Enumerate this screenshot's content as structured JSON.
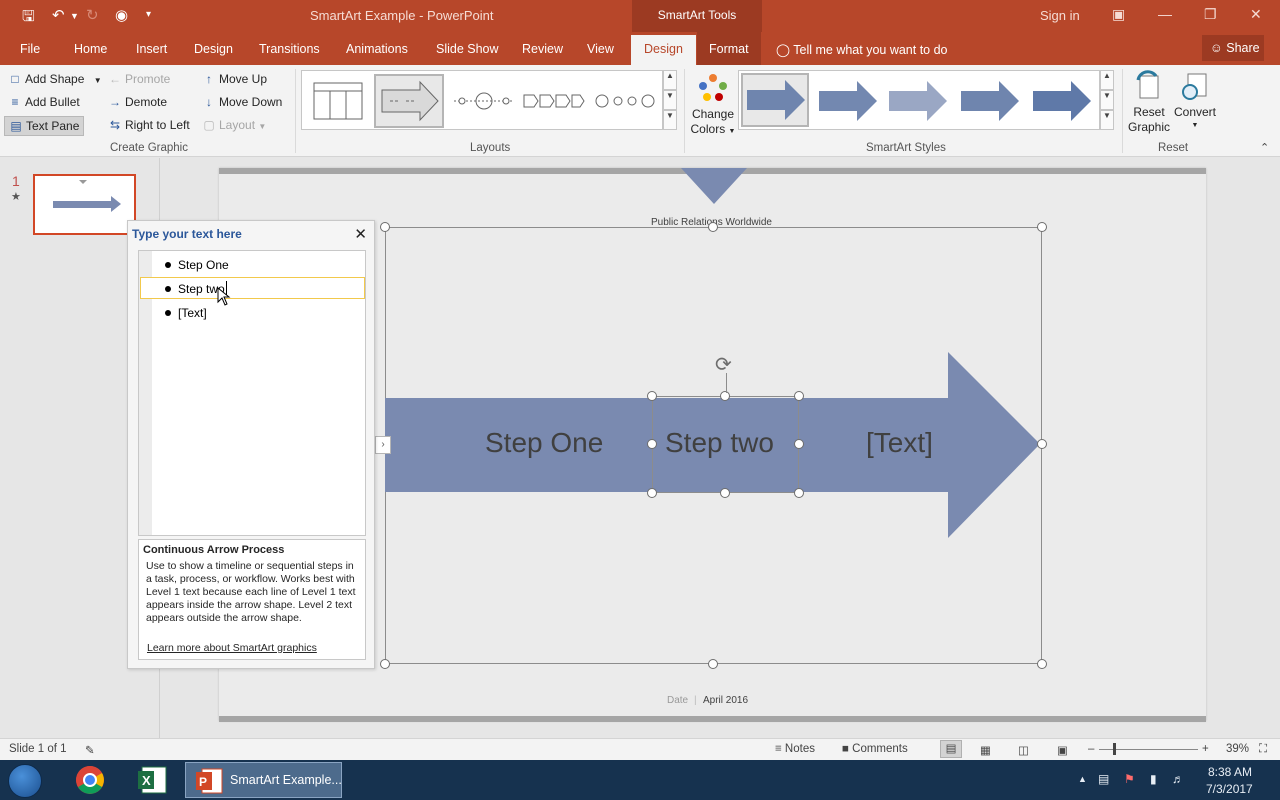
{
  "titlebar": {
    "title": "SmartArt Example  -  PowerPoint",
    "contextual": "SmartArt Tools",
    "signin": "Sign in"
  },
  "tabs": [
    {
      "label": "File"
    },
    {
      "label": "Home"
    },
    {
      "label": "Insert"
    },
    {
      "label": "Design"
    },
    {
      "label": "Transitions"
    },
    {
      "label": "Animations"
    },
    {
      "label": "Slide Show"
    },
    {
      "label": "Review"
    },
    {
      "label": "View"
    },
    {
      "label": "Design"
    },
    {
      "label": "Format"
    }
  ],
  "tellme": "Tell me what you want to do",
  "share": "Share",
  "ribbon": {
    "create_graphic": {
      "add_shape": "Add Shape",
      "add_bullet": "Add Bullet",
      "text_pane": "Text Pane",
      "promote": "Promote",
      "demote": "Demote",
      "right_to_left": "Right to Left",
      "move_up": "Move Up",
      "move_down": "Move Down",
      "layout": "Layout",
      "label": "Create Graphic"
    },
    "layouts": {
      "label": "Layouts"
    },
    "change_colors": {
      "line1": "Change",
      "line2": "Colors"
    },
    "styles": {
      "label": "SmartArt Styles"
    },
    "reset": {
      "reset_line1": "Reset",
      "reset_line2": "Graphic",
      "convert": "Convert",
      "label": "Reset"
    }
  },
  "thumbnails": {
    "slide_number": "1"
  },
  "slide": {
    "header": "Public Relations Worldwide",
    "footer_date": "Date",
    "footer_sep": "|",
    "footer_month": "April 2016",
    "steps": [
      "Step One",
      "Step two",
      "[Text]"
    ]
  },
  "textpane": {
    "heading": "Type your text here",
    "items": [
      "Step One",
      "Step two",
      "[Text]"
    ],
    "desc_title": "Continuous Arrow Process",
    "desc_body": "Use to show a timeline or sequential steps in a task, process, or workflow. Works best with Level 1 text because each line of Level 1 text appears inside the arrow shape. Level 2 text appears outside the arrow shape.",
    "link": "Learn more about SmartArt graphics"
  },
  "statusbar": {
    "slide_info": "Slide 1 of 1",
    "notes": "Notes",
    "comments": "Comments",
    "zoom": "39%"
  },
  "taskbar": {
    "ppt_label": "SmartArt Example...",
    "time": "8:38 AM",
    "date": "7/3/2017"
  },
  "colors": {
    "accent": "#b7472a",
    "arrow": "#7a8ab0"
  }
}
